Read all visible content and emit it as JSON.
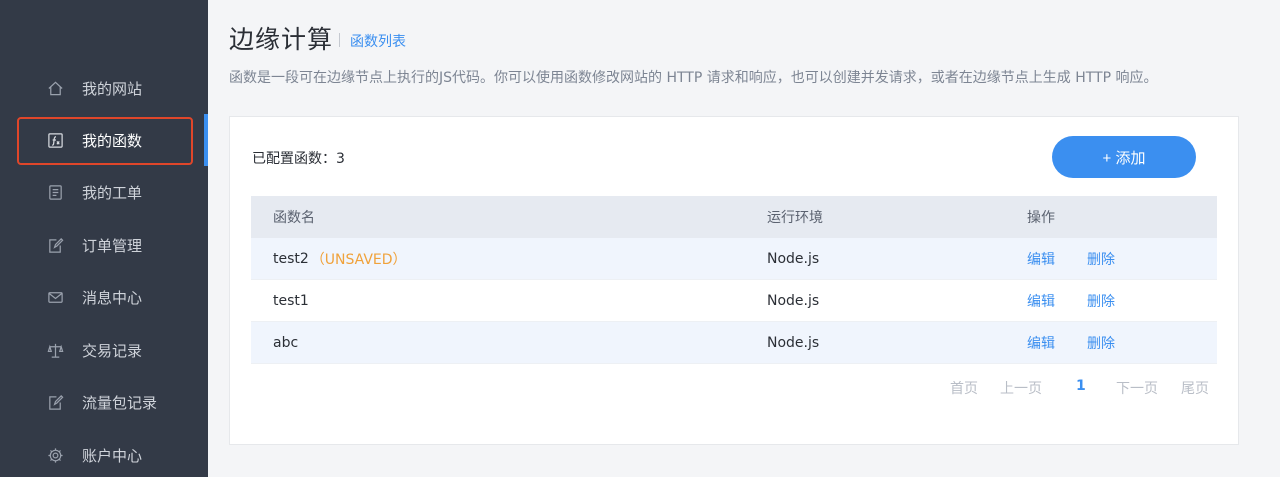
{
  "sidebar": {
    "items": [
      {
        "label": "我的网站",
        "icon": "home-icon"
      },
      {
        "label": "我的函数",
        "icon": "function-icon",
        "active": true
      },
      {
        "label": "我的工单",
        "icon": "ticket-icon"
      },
      {
        "label": "订单管理",
        "icon": "order-edit-icon"
      },
      {
        "label": "消息中心",
        "icon": "mail-icon"
      },
      {
        "label": "交易记录",
        "icon": "scale-icon"
      },
      {
        "label": "流量包记录",
        "icon": "package-edit-icon"
      },
      {
        "label": "账户中心",
        "icon": "gear-icon"
      }
    ]
  },
  "header": {
    "title": "边缘计算",
    "subtitle": "函数列表",
    "description": "函数是一段可在边缘节点上执行的JS代码。你可以使用函数修改网站的 HTTP 请求和响应，也可以创建并发请求，或者在边缘节点上生成 HTTP 响应。"
  },
  "card": {
    "count_label": "已配置函数：3",
    "add_button": "+ 添加"
  },
  "table": {
    "columns": [
      "函数名",
      "运行环境",
      "操作"
    ],
    "rows": [
      {
        "name": "test2",
        "status": "（UNSAVED）",
        "env": "Node.js",
        "edit": "编辑",
        "delete": "删除"
      },
      {
        "name": "test1",
        "status": "",
        "env": "Node.js",
        "edit": "编辑",
        "delete": "删除"
      },
      {
        "name": "abc",
        "status": "",
        "env": "Node.js",
        "edit": "编辑",
        "delete": "删除"
      }
    ]
  },
  "pagination": {
    "first": "首页",
    "prev": "上一页",
    "current": "1",
    "next": "下一页",
    "last": "尾页"
  },
  "colors": {
    "accent": "#3b8ff0",
    "sidebar_bg": "#333a47",
    "highlight_border": "#e0462a",
    "unsaved": "#f0a23b"
  }
}
